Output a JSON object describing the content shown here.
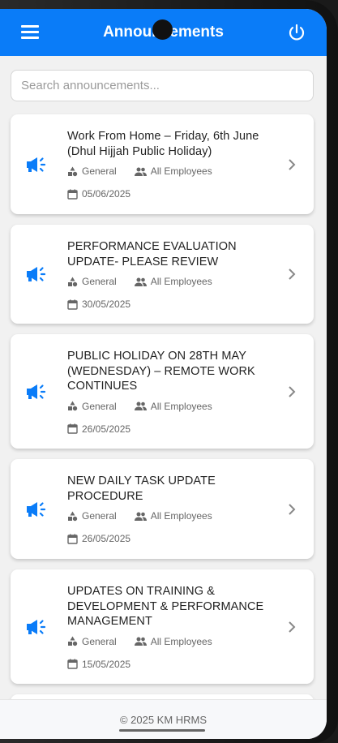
{
  "header": {
    "title": "Announcements"
  },
  "search": {
    "placeholder": "Search announcements..."
  },
  "announcements": [
    {
      "title": "Work From Home – Friday, 6th June (Dhul Hijjah Public Holiday)",
      "category": "General",
      "audience": "All Employees",
      "date": "05/06/2025"
    },
    {
      "title": "PERFORMANCE EVALUATION UPDATE- PLEASE REVIEW",
      "category": "General",
      "audience": "All Employees",
      "date": "30/05/2025"
    },
    {
      "title": "PUBLIC HOLIDAY ON 28TH MAY (WEDNESDAY) – REMOTE WORK CONTINUES",
      "category": "General",
      "audience": "All Employees",
      "date": "26/05/2025"
    },
    {
      "title": "NEW DAILY TASK UPDATE PROCEDURE",
      "category": "General",
      "audience": "All Employees",
      "date": "26/05/2025"
    },
    {
      "title": "UPDATES ON TRAINING & DEVELOPMENT & PERFORMANCE MANAGEMENT",
      "category": "General",
      "audience": "All Employees",
      "date": "15/05/2025"
    }
  ],
  "footer": {
    "text": "© 2025 KM HRMS"
  },
  "colors": {
    "primary": "#0a7cf8"
  }
}
